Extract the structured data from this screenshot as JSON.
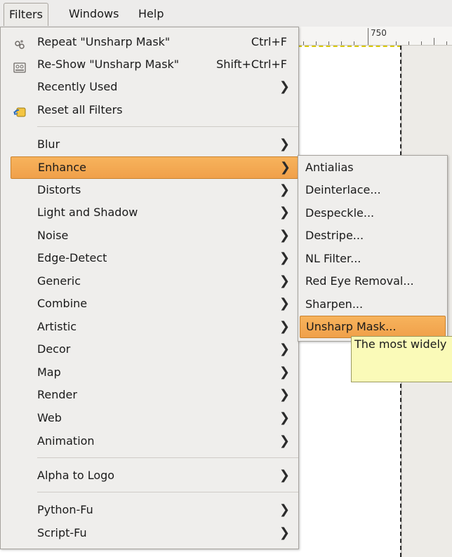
{
  "menubar": {
    "items": [
      "Filters",
      "Windows",
      "Help"
    ]
  },
  "ruler": {
    "label": "750"
  },
  "filters_menu": {
    "items": [
      {
        "label": "Repeat \"Unsharp Mask\"",
        "accel": "Ctrl+F",
        "icon": "repeat-filter-icon"
      },
      {
        "label": "Re-Show \"Unsharp Mask\"",
        "accel": "Shift+Ctrl+F",
        "icon": "reshow-filter-icon"
      },
      {
        "label": "Recently Used",
        "submenu": true
      },
      {
        "label": "Reset all Filters",
        "icon": "reset-filters-icon"
      },
      {
        "label": "Blur",
        "submenu": true
      },
      {
        "label": "Enhance",
        "submenu": true,
        "highlighted": true
      },
      {
        "label": "Distorts",
        "submenu": true
      },
      {
        "label": "Light and Shadow",
        "submenu": true
      },
      {
        "label": "Noise",
        "submenu": true
      },
      {
        "label": "Edge-Detect",
        "submenu": true
      },
      {
        "label": "Generic",
        "submenu": true
      },
      {
        "label": "Combine",
        "submenu": true
      },
      {
        "label": "Artistic",
        "submenu": true
      },
      {
        "label": "Decor",
        "submenu": true
      },
      {
        "label": "Map",
        "submenu": true
      },
      {
        "label": "Render",
        "submenu": true
      },
      {
        "label": "Web",
        "submenu": true
      },
      {
        "label": "Animation",
        "submenu": true
      },
      {
        "label": "Alpha to Logo",
        "submenu": true
      },
      {
        "label": "Python-Fu",
        "submenu": true
      },
      {
        "label": "Script-Fu",
        "submenu": true
      }
    ]
  },
  "enhance_menu": {
    "items": [
      {
        "label": "Antialias"
      },
      {
        "label": "Deinterlace..."
      },
      {
        "label": "Despeckle..."
      },
      {
        "label": "Destripe..."
      },
      {
        "label": "NL Filter..."
      },
      {
        "label": "Red Eye Removal..."
      },
      {
        "label": "Sharpen..."
      },
      {
        "label": "Unsharp Mask...",
        "highlighted": true
      }
    ]
  },
  "tooltip": {
    "text": "The most widely"
  },
  "colors": {
    "highlight": "#f0a04a",
    "menu_bg": "#efeeec",
    "tooltip_bg": "#fafab8"
  }
}
